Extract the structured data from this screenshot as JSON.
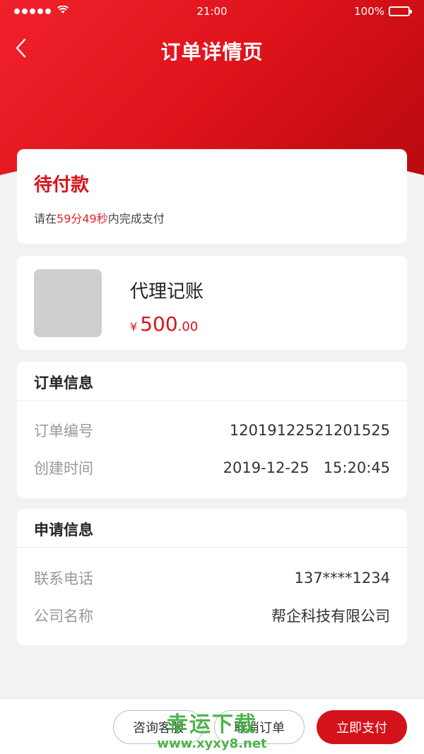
{
  "status_bar": {
    "time": "21:00",
    "battery": "100%"
  },
  "nav": {
    "title": "订单详情页"
  },
  "order_status": {
    "title": "待付款",
    "prefix": "请在",
    "countdown": "59分49秒",
    "suffix": "内完成支付"
  },
  "product": {
    "name": "代理记账",
    "currency": "¥",
    "price_int": "500",
    "price_dec": ".00"
  },
  "order_info": {
    "heading": "订单信息",
    "rows": [
      {
        "label": "订单编号",
        "value": "12019122521201525"
      },
      {
        "label": "创建时间",
        "value": "2019-12-25   15:20:45"
      }
    ]
  },
  "apply_info": {
    "heading": "申请信息",
    "rows": [
      {
        "label": "联系电话",
        "value": "137****1234"
      },
      {
        "label": "公司名称",
        "value": "帮企科技有限公司"
      }
    ]
  },
  "actions": {
    "consult": "咨询客服",
    "cancel": "取消订单",
    "pay": "立即支付"
  },
  "watermark": {
    "text": "幸运下载",
    "url": "www.xyxy8.net"
  },
  "colors": {
    "accent": "#d4121a",
    "background": "#f2f2f2"
  }
}
